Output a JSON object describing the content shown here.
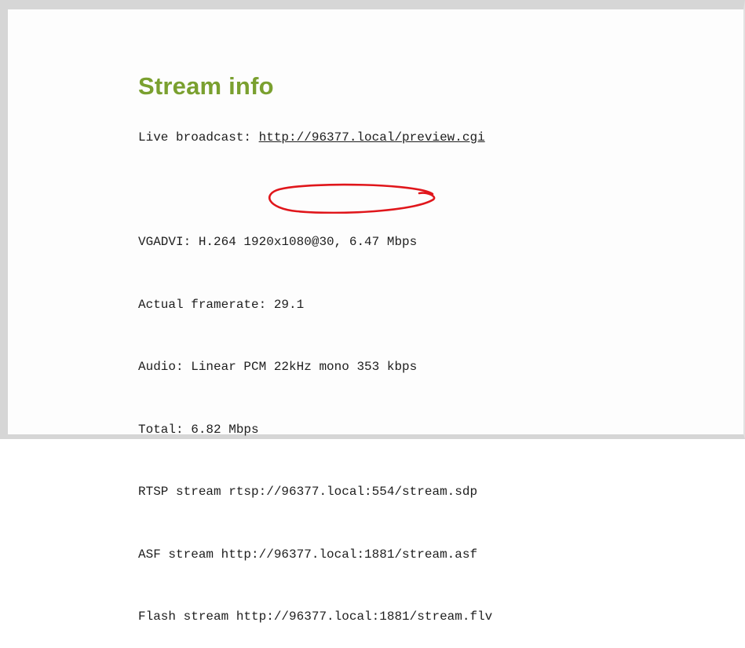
{
  "page": {
    "title": "Stream info",
    "live_broadcast_label": "Live broadcast: ",
    "live_broadcast_url": "http://96377.local/preview.cgi",
    "info_lines": [
      "VGADVI: H.264 1920x1080@30, 6.47 Mbps",
      "Actual framerate: 29.1",
      "Audio: Linear PCM 22kHz mono 353 kbps",
      "Total: 6.82 Mbps",
      "RTSP stream rtsp://96377.local:554/stream.sdp",
      "ASF stream http://96377.local:1881/stream.asf",
      "Flash stream http://96377.local:1881/stream.flv"
    ]
  },
  "annotation": {
    "color": "#e0161b",
    "shape": "ellipse"
  },
  "colors": {
    "title": "#7aa02f",
    "text": "#1e1e1e",
    "border": "#d6d6d6"
  }
}
